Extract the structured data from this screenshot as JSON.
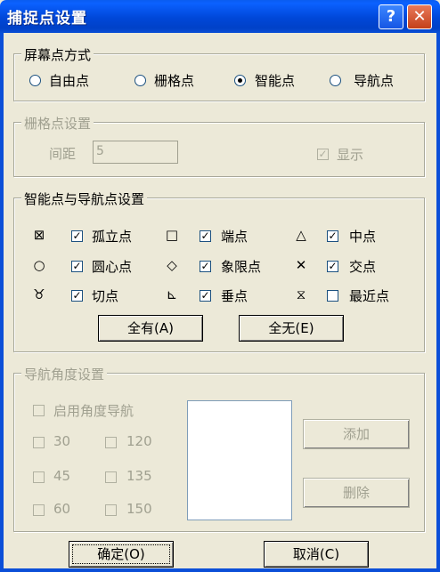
{
  "window": {
    "title": "捕捉点设置",
    "help": "?",
    "close": "✕"
  },
  "screen_mode": {
    "label": "屏幕点方式",
    "options": [
      "自由点",
      "栅格点",
      "智能点",
      "导航点"
    ],
    "selected": "智能点"
  },
  "grid": {
    "label": "栅格点设置",
    "spacing_label": "间距",
    "spacing_value": "5",
    "show_label": "显示",
    "show_checked": true
  },
  "snap": {
    "label": "智能点与导航点设置",
    "items": [
      {
        "symbol": "⊠",
        "label": "孤立点",
        "checked": true
      },
      {
        "symbol": "□",
        "label": "端点",
        "checked": true
      },
      {
        "symbol": "△",
        "label": "中点",
        "checked": true
      },
      {
        "symbol": "○",
        "label": "圆心点",
        "checked": true
      },
      {
        "symbol": "◇",
        "label": "象限点",
        "checked": true
      },
      {
        "symbol": "✕",
        "label": "交点",
        "checked": true
      },
      {
        "symbol": "♉",
        "label": "切点",
        "checked": true
      },
      {
        "symbol": "⊾",
        "label": "垂点",
        "checked": true
      },
      {
        "symbol": "⧖",
        "label": "最近点",
        "checked": false
      }
    ],
    "all_button": "全有(A)",
    "none_button": "全无(E)"
  },
  "nav_angle": {
    "label": "导航角度设置",
    "enable_label": "启用角度导航",
    "angles": [
      "30",
      "120",
      "45",
      "135",
      "60",
      "150"
    ],
    "add_button": "添加",
    "delete_button": "删除"
  },
  "footer": {
    "ok_button": "确定(O)",
    "cancel_button": "取消(C)"
  }
}
